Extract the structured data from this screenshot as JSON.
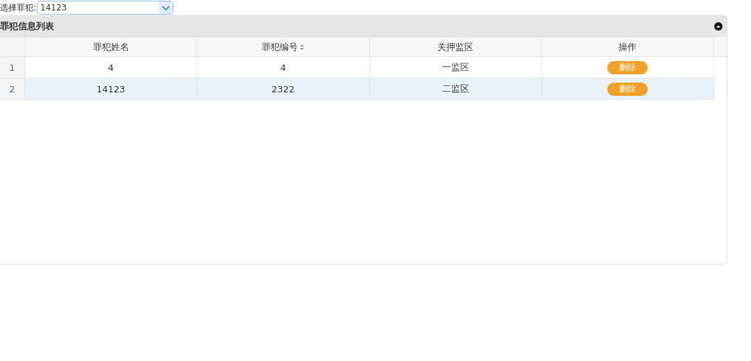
{
  "filter": {
    "label": "选择罪犯:",
    "value": "14123"
  },
  "panel": {
    "title": "罪犯信息列表",
    "expanded": true
  },
  "table": {
    "columns": [
      {
        "label": "罪犯姓名",
        "sortable": false
      },
      {
        "label": "罪犯编号",
        "sortable": true
      },
      {
        "label": "关押监区",
        "sortable": false
      },
      {
        "label": "操作",
        "sortable": false
      }
    ],
    "rows": [
      {
        "index": "1",
        "cells": [
          "4",
          "4",
          "一监区"
        ],
        "action": "删除",
        "selected": false
      },
      {
        "index": "2",
        "cells": [
          "14123",
          "2322",
          "二监区"
        ],
        "action": "删除",
        "selected": true
      }
    ]
  }
}
